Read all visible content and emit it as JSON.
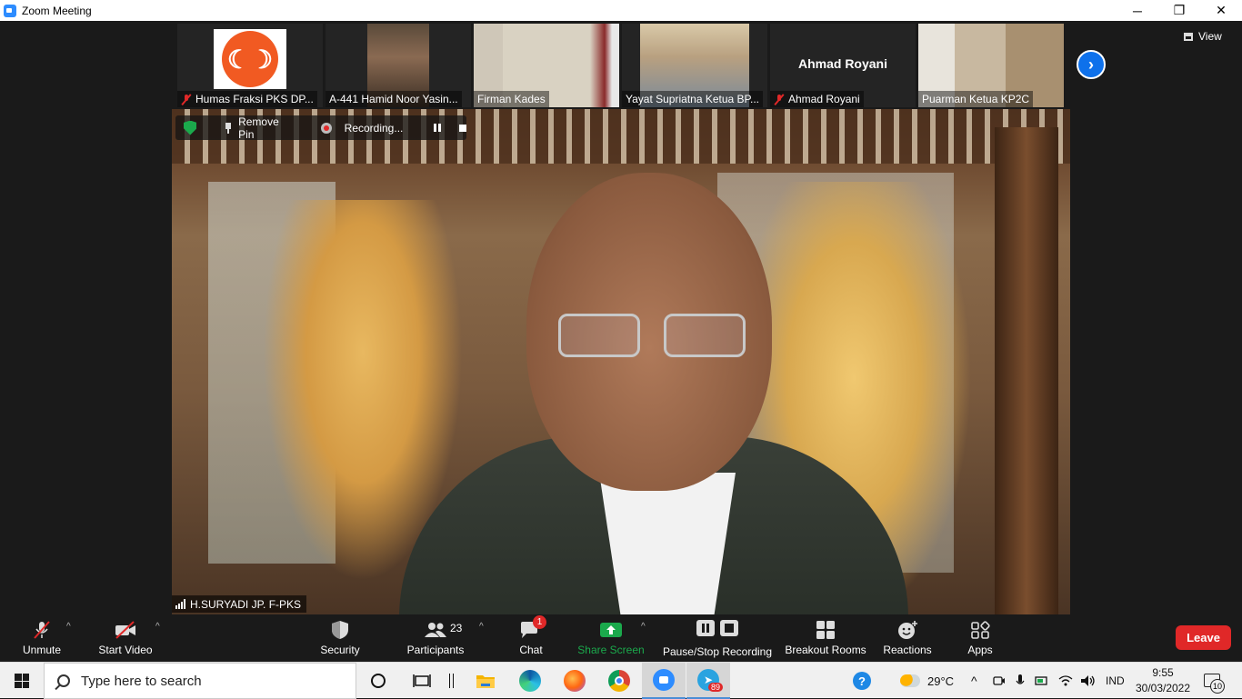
{
  "window": {
    "title": "Zoom Meeting",
    "minimize": "─",
    "maximize": "❐",
    "close": "✕"
  },
  "thumbnails": [
    {
      "name": "Humas Fraksi PKS DP...",
      "muted": true,
      "kind": "logo",
      "logo_text": "☾☽"
    },
    {
      "name": "A-441 Hamid Noor Yasin...",
      "muted": false,
      "kind": "video"
    },
    {
      "name": "Firman Kades",
      "muted": false,
      "kind": "video"
    },
    {
      "name": "Yayat Supriatna Ketua BP...",
      "muted": false,
      "kind": "video"
    },
    {
      "name": "Ahmad Royani",
      "muted": true,
      "kind": "name-only",
      "big_name": "Ahmad Royani"
    },
    {
      "name": "Puarman Ketua KP2C",
      "muted": false,
      "kind": "video"
    }
  ],
  "gallery": {
    "next_label": "›",
    "view_label": "View"
  },
  "main_video": {
    "remove_pin": "Remove Pin",
    "recording": "Recording...",
    "speaker_name": "H.SURYADI JP. F-PKS"
  },
  "toolbar": {
    "unmute": "Unmute",
    "start_video": "Start Video",
    "security": "Security",
    "participants": "Participants",
    "participants_count": "23",
    "chat": "Chat",
    "chat_badge": "1",
    "share_screen": "Share Screen",
    "pause_stop_recording": "Pause/Stop Recording",
    "breakout_rooms": "Breakout Rooms",
    "reactions": "Reactions",
    "apps": "Apps",
    "leave": "Leave",
    "caret": "^"
  },
  "taskbar": {
    "search_placeholder": "Type here to search",
    "telegram_badge": "89",
    "weather": "29°C",
    "language": "IND",
    "time": "9:55",
    "date": "30/03/2022",
    "notifications": "10"
  },
  "colors": {
    "zoom_blue": "#0e71eb",
    "share_green": "#1ba94c",
    "leave_red": "#e02828",
    "pks_orange": "#f15a22"
  }
}
